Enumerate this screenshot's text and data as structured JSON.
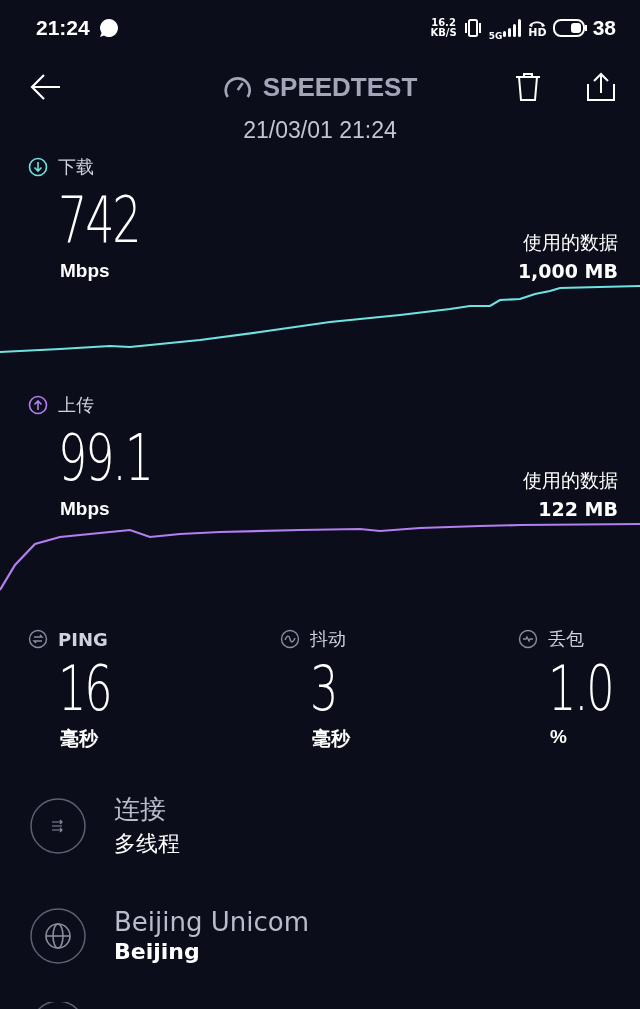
{
  "status_bar": {
    "time": "21:24",
    "net_speed": [
      "16.2",
      "KB/S"
    ],
    "network": "5G",
    "call_label": "HD",
    "battery": "38"
  },
  "header": {
    "title": "SPEEDTEST",
    "date": "21/03/01 21:24"
  },
  "results": [
    {
      "kind": "download",
      "label": "下载",
      "value": "742",
      "unit": "Mbps",
      "data_label": "使用的数据",
      "data_value": "1,000 MB"
    },
    {
      "kind": "upload",
      "label": "上传",
      "value": "99.1",
      "unit": "Mbps",
      "data_label": "使用的数据",
      "data_value": "122 MB"
    }
  ],
  "metrics": [
    {
      "kind": "ping",
      "label": "PING",
      "value": "16",
      "unit": "毫秒"
    },
    {
      "kind": "jitter",
      "label": "抖动",
      "value": "3",
      "unit": "毫秒"
    },
    {
      "kind": "loss",
      "label": "丢包",
      "value": "1.0",
      "unit": "%"
    }
  ],
  "details": [
    {
      "kind": "connections",
      "title": "连接",
      "subtitle": "多线程"
    },
    {
      "kind": "server",
      "title": "Beijing Unicom",
      "subtitle": "Beijing"
    }
  ]
}
